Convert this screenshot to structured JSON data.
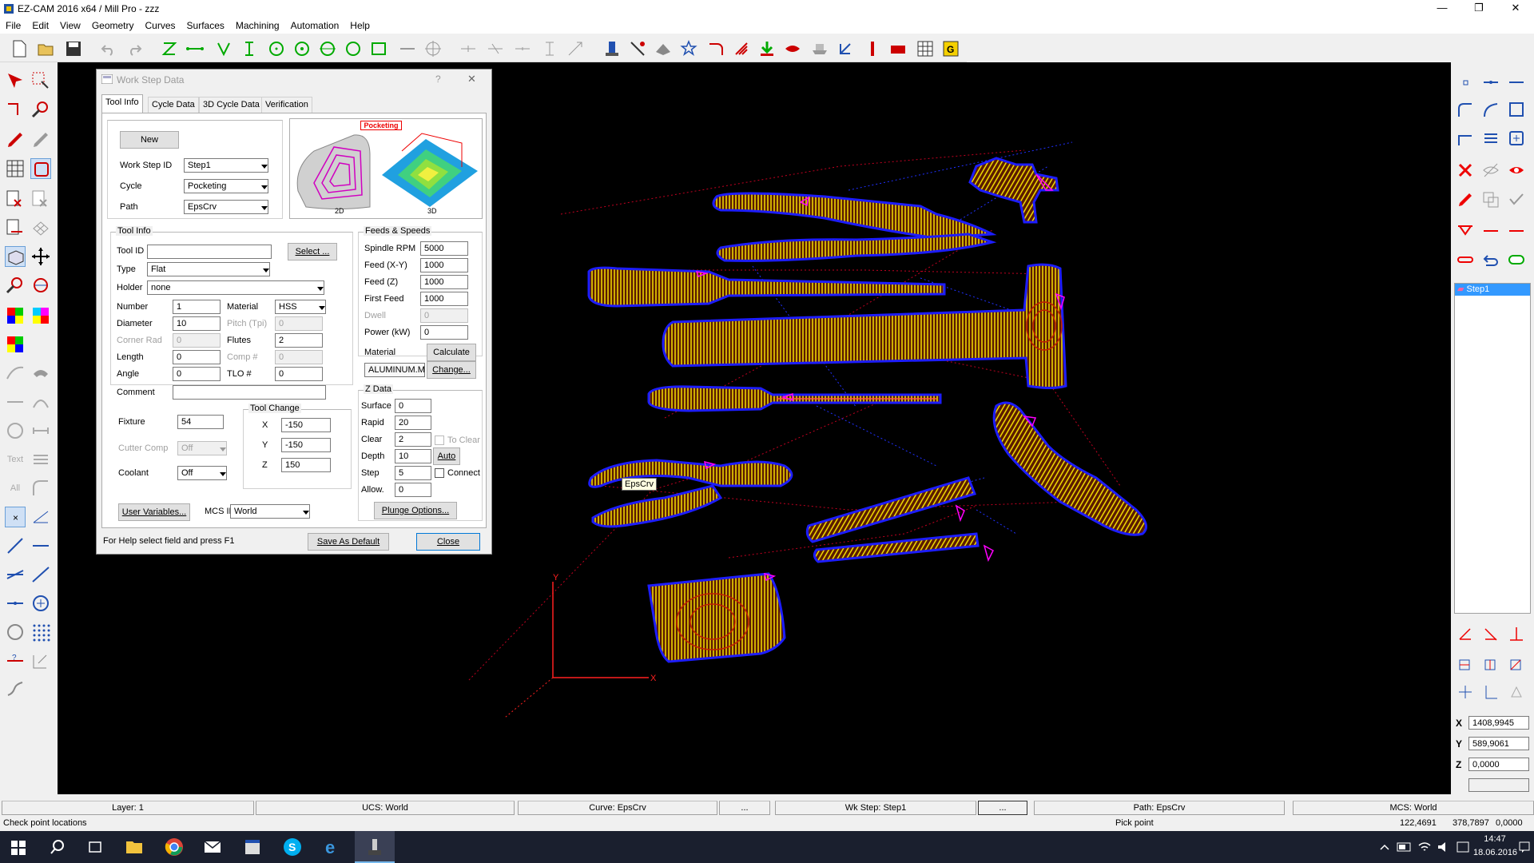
{
  "app": {
    "title": "EZ-CAM 2016 x64 / Mill Pro  - zzz"
  },
  "menu": [
    "File",
    "Edit",
    "View",
    "Geometry",
    "Curves",
    "Surfaces",
    "Machining",
    "Automation",
    "Help"
  ],
  "dialog": {
    "title": "Work Step Data",
    "help_glyph": "?",
    "close_glyph": "✕",
    "tabs": [
      "Tool Info",
      "Cycle Data",
      "3D Cycle Data",
      "Verification"
    ],
    "new_button": "New",
    "work_step_id_label": "Work Step ID",
    "work_step_id": "Step1",
    "cycle_label": "Cycle",
    "cycle": "Pocketing",
    "path_label": "Path",
    "path": "EpsCrv",
    "preview": {
      "badge": "Pocketing",
      "label_2d": "2D",
      "label_3d": "3D"
    },
    "tool_info": {
      "group_title": "Tool Info",
      "tool_id_label": "Tool ID",
      "tool_id": "",
      "select_button": "Select ...",
      "type_label": "Type",
      "type": "Flat",
      "holder_label": "Holder",
      "holder": "none",
      "number_label": "Number",
      "number": "1",
      "material_label": "Material",
      "material": "HSS",
      "diameter_label": "Diameter",
      "diameter": "10",
      "pitch_label": "Pitch (Tpi)",
      "pitch": "0",
      "corner_rad_label": "Corner Rad",
      "corner_rad": "0",
      "flutes_label": "Flutes",
      "flutes": "2",
      "length_label": "Length",
      "length": "0",
      "comp_label": "Comp #",
      "comp": "0",
      "angle_label": "Angle",
      "angle": "0",
      "tlo_label": "TLO #",
      "tlo": "0",
      "comment_label": "Comment",
      "comment": ""
    },
    "feeds": {
      "group_title": "Feeds & Speeds",
      "spindle_label": "Spindle RPM",
      "spindle": "5000",
      "feed_xy_label": "Feed (X-Y)",
      "feed_xy": "1000",
      "feed_z_label": "Feed (Z)",
      "feed_z": "1000",
      "first_feed_label": "First Feed",
      "first_feed": "1000",
      "dwell_label": "Dwell",
      "dwell": "0",
      "power_label": "Power (kW)",
      "power": "0",
      "material_label": "Material",
      "calculate_button": "Calculate",
      "material_file": "ALUMINUM.MTL",
      "change_button": "Change..."
    },
    "fixture_label": "Fixture",
    "fixture": "54",
    "cutter_comp_label": "Cutter Comp",
    "cutter_comp": "Off",
    "coolant_label": "Coolant",
    "coolant": "Off",
    "tool_change": {
      "group_title": "Tool Change",
      "x_label": "X",
      "x": "-150",
      "y_label": "Y",
      "y": "-150",
      "z_label": "Z",
      "z": "150"
    },
    "zdata": {
      "group_title": "Z Data",
      "surface_label": "Surface",
      "surface": "0",
      "rapid_label": "Rapid",
      "rapid": "20",
      "clear_label": "Clear",
      "clear": "2",
      "to_clear_label": "To Clear",
      "depth_label": "Depth",
      "depth": "10",
      "auto_button": "Auto",
      "step_label": "Step",
      "step": "5",
      "connect_label": "Connect",
      "allow_label": "Allow.",
      "allow": "0",
      "plunge_button": "Plunge Options..."
    },
    "user_vars_button": "User Variables...",
    "mcs_id_label": "MCS ID",
    "mcs_id": "World",
    "help_text": "For Help select field and press F1",
    "save_default_button": "Save As Default",
    "close_button": "Close"
  },
  "canvas": {
    "tooltip": "EpsCrv",
    "axis_x": "X",
    "axis_y": "Y"
  },
  "right_panel": {
    "step_item": "Step1",
    "x_label": "X",
    "x": "1408,9945",
    "y_label": "Y",
    "y": "589,9061",
    "z_label": "Z",
    "z": "0,0000"
  },
  "status": {
    "layer": "Layer: 1",
    "ucs": "UCS: World",
    "curve": "Curve: EpsCrv",
    "dots1": "...",
    "wkstep": "Wk Step: Step1",
    "dots2": "...",
    "path": "Path: EpsCrv",
    "mcs": "MCS: World"
  },
  "info": {
    "left": "Check point locations",
    "center": "Pick point",
    "coord1": "122,4691",
    "coord2": "378,7897",
    "coord3": "0,0000"
  },
  "taskbar": {
    "time": "14:47",
    "date": "18.06.2016"
  },
  "colors": {
    "canvas": "#000000",
    "toolpath": "#ffff00",
    "border": "#0000ff",
    "selection": "#3399ff"
  }
}
